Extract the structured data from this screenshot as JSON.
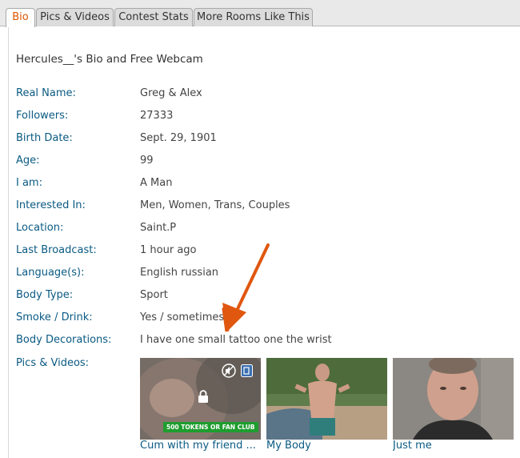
{
  "tabs": [
    {
      "label": "Bio",
      "active": true
    },
    {
      "label": "Pics & Videos",
      "active": false
    },
    {
      "label": "Contest Stats",
      "active": false
    },
    {
      "label": "More Rooms Like This",
      "active": false
    }
  ],
  "heading": "Hercules__'s Bio and Free Webcam",
  "bio": [
    {
      "label": "Real Name:",
      "value": "Greg & Alex"
    },
    {
      "label": "Followers:",
      "value": "27333"
    },
    {
      "label": "Birth Date:",
      "value": "Sept. 29, 1901"
    },
    {
      "label": "Age:",
      "value": "99"
    },
    {
      "label": "I am:",
      "value": "A Man"
    },
    {
      "label": "Interested In:",
      "value": "Men, Women, Trans, Couples"
    },
    {
      "label": "Location:",
      "value": "Saint.P"
    },
    {
      "label": "Last Broadcast:",
      "value": "1 hour ago"
    },
    {
      "label": "Language(s):",
      "value": "English russian"
    },
    {
      "label": "Body Type:",
      "value": "Sport"
    },
    {
      "label": "Smoke / Drink:",
      "value": "Yes / sometimes"
    },
    {
      "label": "Body Decorations:",
      "value": "I have one small tattoo one the wrist"
    },
    {
      "label": "Pics & Videos:",
      "value": ""
    }
  ],
  "media": [
    {
      "caption": "Cum with my friend ...",
      "badge": "500 TOKENS OR FAN CLUB",
      "locked": true
    },
    {
      "caption": "My Body"
    },
    {
      "caption": "Just me"
    }
  ],
  "colors": {
    "accent": "#dc5500",
    "label": "#0a5a83",
    "badge": "#1f9d2f",
    "arrow": "#e0570f"
  }
}
